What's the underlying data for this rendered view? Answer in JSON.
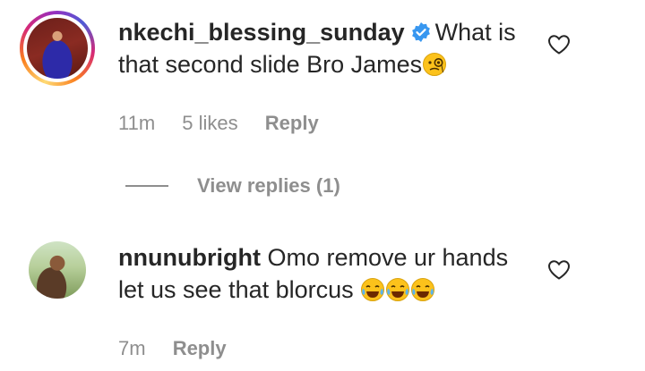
{
  "comments": [
    {
      "username": "nkechi_blessing_sunday",
      "verified": true,
      "text_line1": "What is",
      "text_line2": "that second slide Bro James",
      "time": "11m",
      "likes": "5 likes",
      "reply_label": "Reply",
      "emoji": "face-with-monocle-icon"
    },
    {
      "username": "nnunubright",
      "verified": false,
      "text_line1": "Omo remove ur hands",
      "text_line2": "let us see that blorcus",
      "time": "7m",
      "reply_label": "Reply",
      "emoji": "laughing-tears-icon"
    }
  ],
  "view_replies_label": "View replies (1)",
  "colors": {
    "text": "#262626",
    "muted": "#8e8e8e",
    "verified_blue": "#3897f0"
  }
}
